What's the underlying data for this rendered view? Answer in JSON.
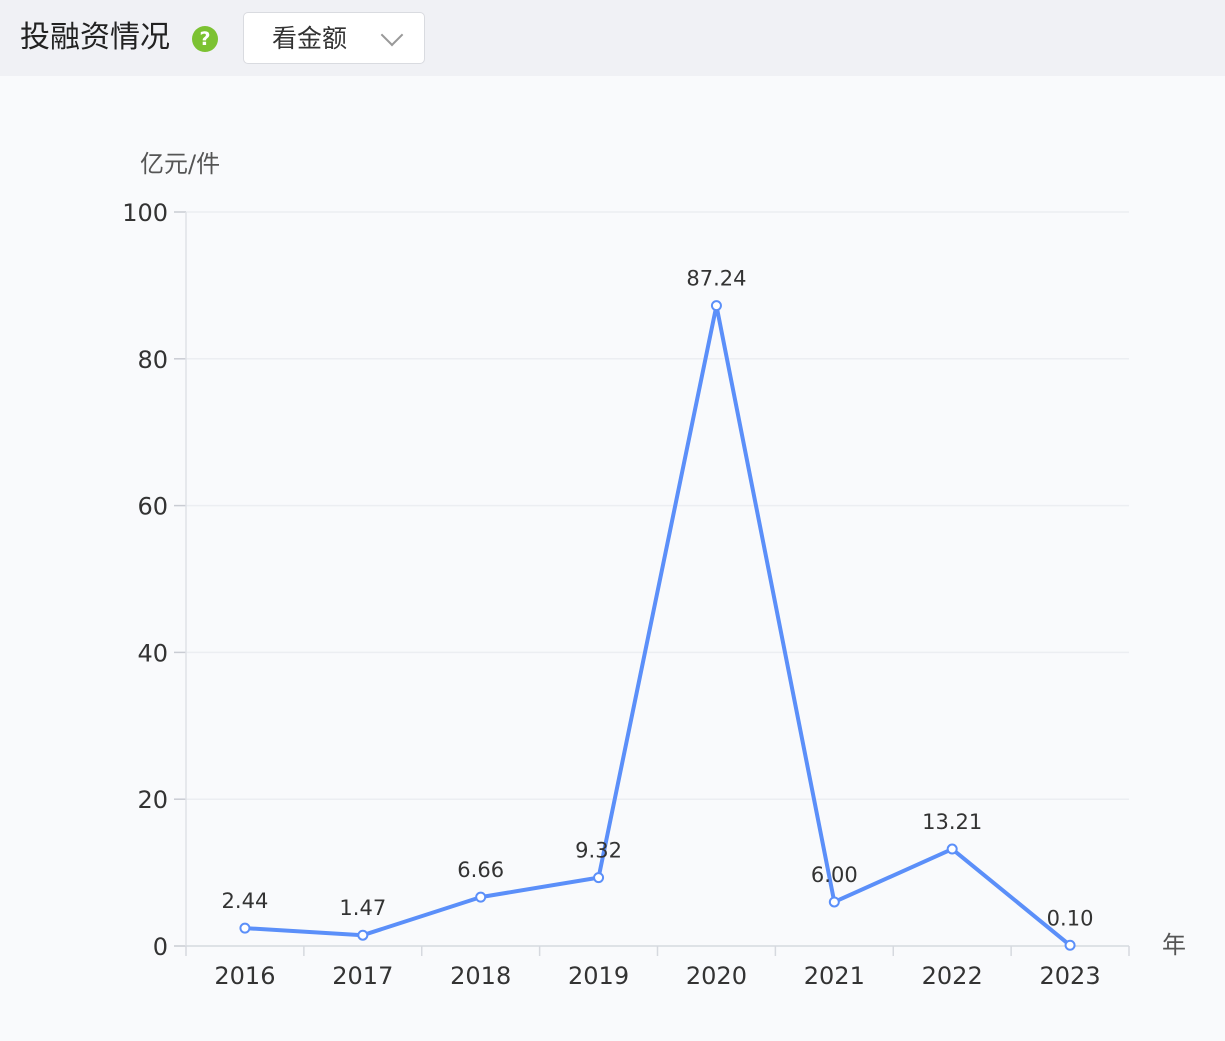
{
  "header": {
    "title": "投融资情况",
    "help_icon": "question-circle-icon",
    "help_symbol": "?",
    "dropdown": {
      "selected": "看金额",
      "icon": "chevron-down-icon"
    }
  },
  "chart_data": {
    "type": "line",
    "categories": [
      "2016",
      "2017",
      "2018",
      "2019",
      "2020",
      "2021",
      "2022",
      "2023"
    ],
    "series": [
      {
        "values": [
          2.44,
          1.47,
          6.66,
          9.32,
          87.24,
          6.0,
          13.21,
          0.1
        ],
        "labels": [
          "2.44",
          "1.47",
          "6.66",
          "9.32",
          "87.24",
          "6.00",
          "13.21",
          "0.10"
        ],
        "color": "#5b8ff9"
      }
    ],
    "ylabel": "亿元/件",
    "xlabel": "年",
    "ylim": [
      0,
      100
    ],
    "yticks": [
      0,
      20,
      40,
      60,
      80,
      100
    ],
    "grid": true,
    "legend": "none"
  }
}
